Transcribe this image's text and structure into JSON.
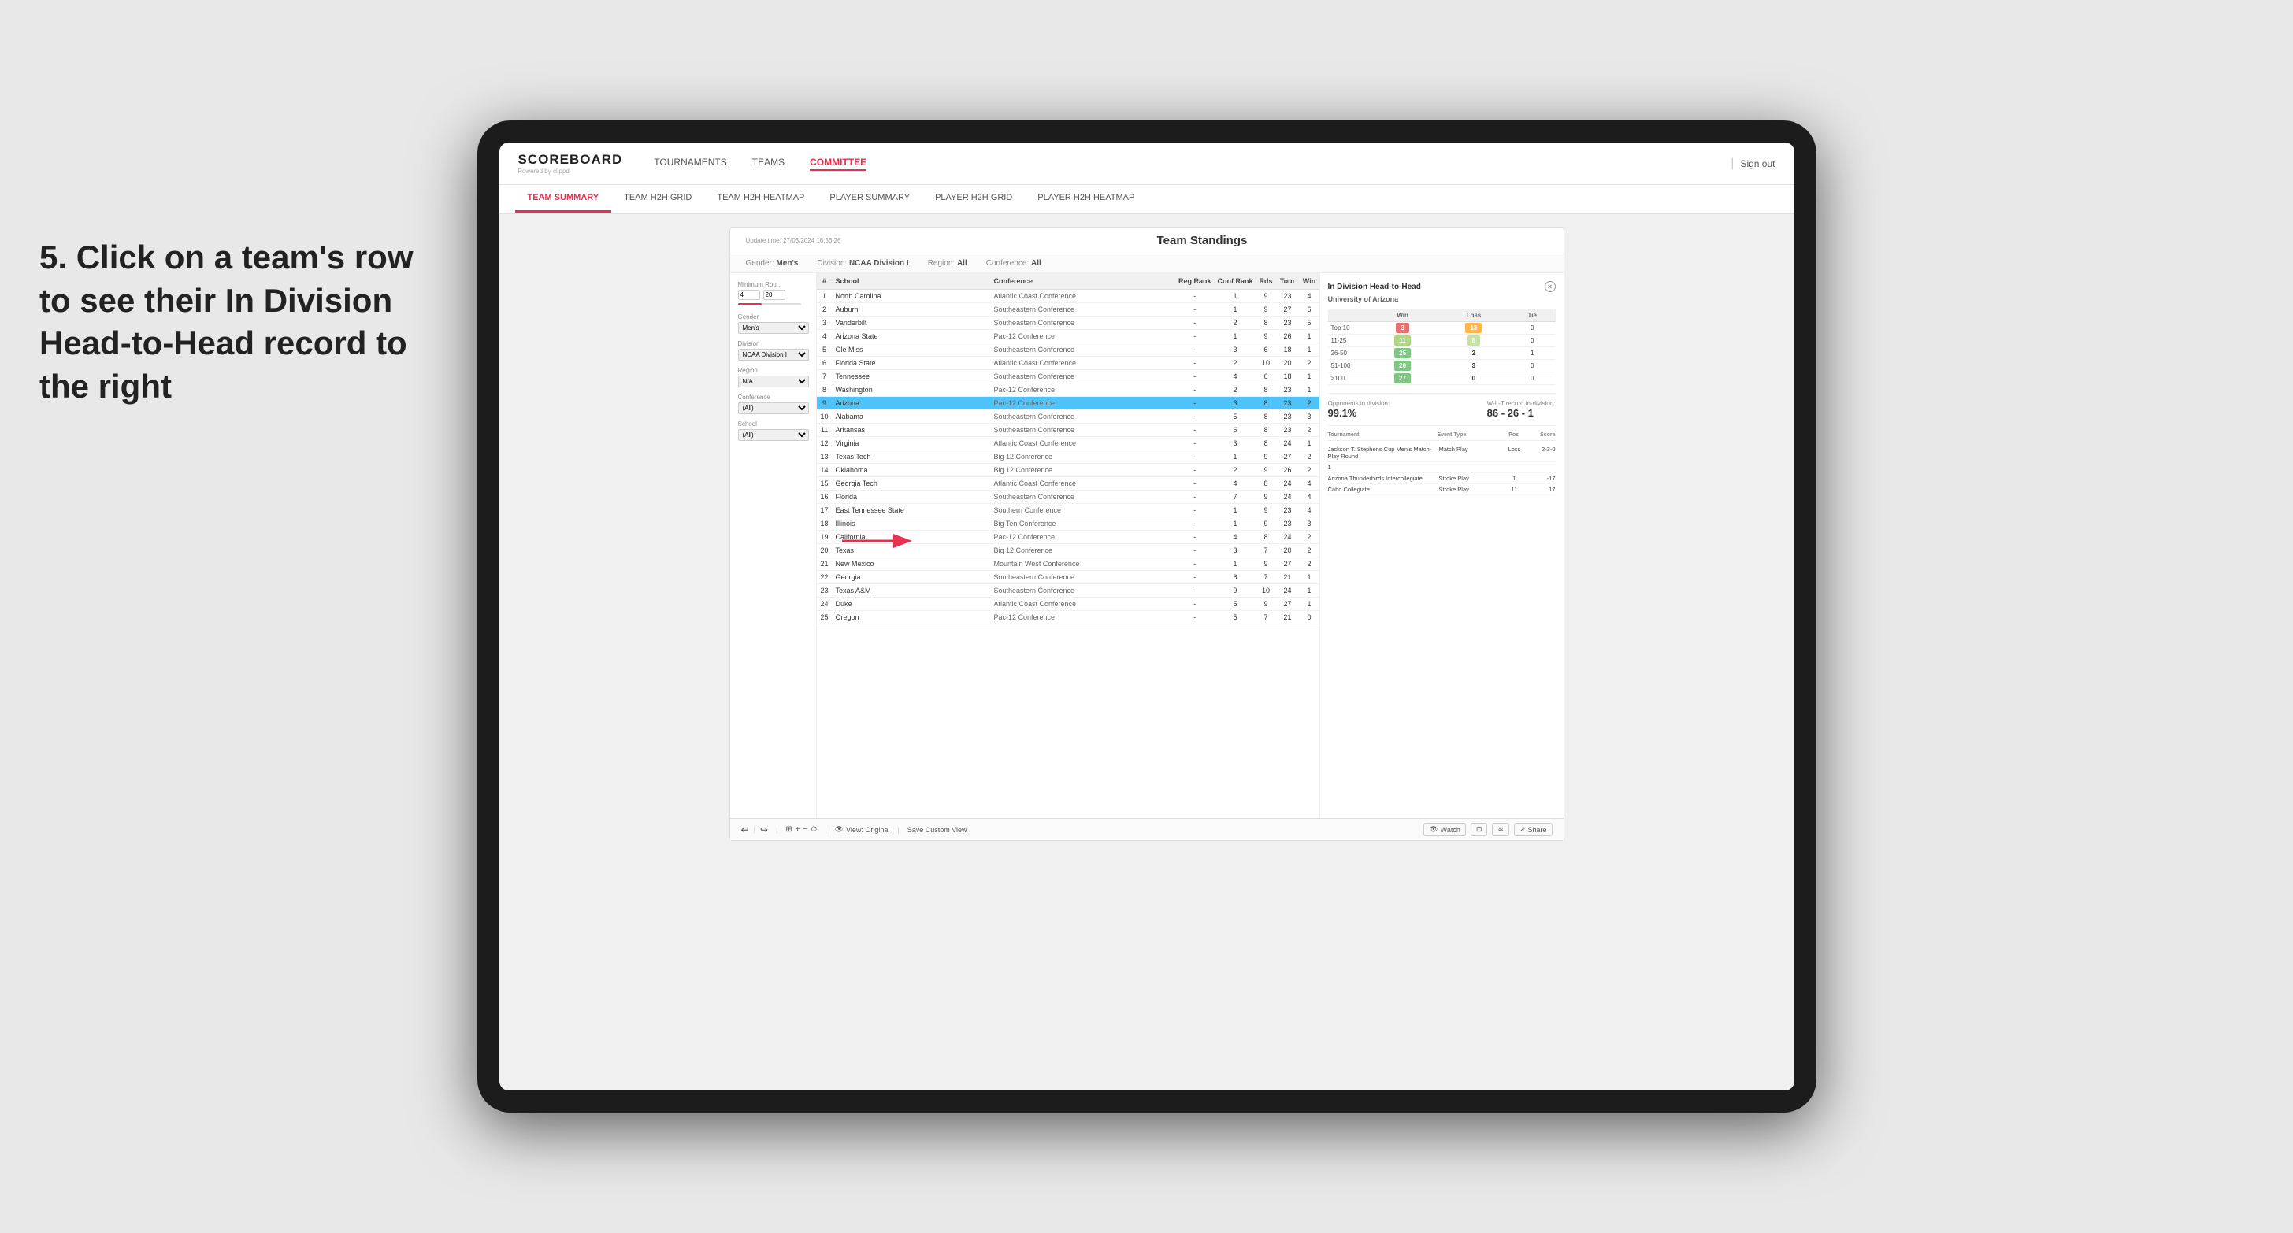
{
  "app": {
    "logo": "SCOREBOARD",
    "logo_sub": "Powered by clippd",
    "sign_out": "Sign out"
  },
  "nav": {
    "links": [
      "TOURNAMENTS",
      "TEAMS",
      "COMMITTEE"
    ],
    "active": "COMMITTEE"
  },
  "subnav": {
    "links": [
      "TEAM SUMMARY",
      "TEAM H2H GRID",
      "TEAM H2H HEATMAP",
      "PLAYER SUMMARY",
      "PLAYER H2H GRID",
      "PLAYER H2H HEATMAP"
    ],
    "active": "PLAYER SUMMARY"
  },
  "annotation": {
    "text": "5. Click on a team's row to see their In Division Head-to-Head record to the right"
  },
  "panel": {
    "update_time": "Update time:\n27/03/2024 16:56:26",
    "title": "Team Standings",
    "filters": {
      "gender_label": "Gender:",
      "gender_value": "Men's",
      "division_label": "Division:",
      "division_value": "NCAA Division I",
      "region_label": "Region:",
      "region_value": "All",
      "conference_label": "Conference:",
      "conference_value": "All"
    },
    "sidebar": {
      "min_rounds_label": "Minimum Rou...",
      "min_val": "4",
      "max_val": "20",
      "gender_label": "Gender",
      "gender_value": "Men's",
      "division_label": "Division",
      "division_value": "NCAA Division I",
      "region_label": "Region",
      "region_value": "N/A",
      "conference_label": "Conference",
      "conference_value": "(All)",
      "school_label": "School",
      "school_value": "(All)"
    },
    "table": {
      "headers": [
        "#",
        "School",
        "Conference",
        "Reg Rank",
        "Conf Rank",
        "Rds",
        "Tour",
        "Win"
      ],
      "rows": [
        {
          "num": "1",
          "school": "North Carolina",
          "conf": "Atlantic Coast Conference",
          "reg": "-",
          "crank": "1",
          "rds": "9",
          "tour": "23",
          "win": "4"
        },
        {
          "num": "2",
          "school": "Auburn",
          "conf": "Southeastern Conference",
          "reg": "-",
          "crank": "1",
          "rds": "9",
          "tour": "27",
          "win": "6"
        },
        {
          "num": "3",
          "school": "Vanderbilt",
          "conf": "Southeastern Conference",
          "reg": "-",
          "crank": "2",
          "rds": "8",
          "tour": "23",
          "win": "5"
        },
        {
          "num": "4",
          "school": "Arizona State",
          "conf": "Pac-12 Conference",
          "reg": "-",
          "crank": "1",
          "rds": "9",
          "tour": "26",
          "win": "1"
        },
        {
          "num": "5",
          "school": "Ole Miss",
          "conf": "Southeastern Conference",
          "reg": "-",
          "crank": "3",
          "rds": "6",
          "tour": "18",
          "win": "1"
        },
        {
          "num": "6",
          "school": "Florida State",
          "conf": "Atlantic Coast Conference",
          "reg": "-",
          "crank": "2",
          "rds": "10",
          "tour": "20",
          "win": "2"
        },
        {
          "num": "7",
          "school": "Tennessee",
          "conf": "Southeastern Conference",
          "reg": "-",
          "crank": "4",
          "rds": "6",
          "tour": "18",
          "win": "1"
        },
        {
          "num": "8",
          "school": "Washington",
          "conf": "Pac-12 Conference",
          "reg": "-",
          "crank": "2",
          "rds": "8",
          "tour": "23",
          "win": "1"
        },
        {
          "num": "9",
          "school": "Arizona",
          "conf": "Pac-12 Conference",
          "reg": "-",
          "crank": "3",
          "rds": "8",
          "tour": "23",
          "win": "2",
          "highlight": true
        },
        {
          "num": "10",
          "school": "Alabama",
          "conf": "Southeastern Conference",
          "reg": "-",
          "crank": "5",
          "rds": "8",
          "tour": "23",
          "win": "3"
        },
        {
          "num": "11",
          "school": "Arkansas",
          "conf": "Southeastern Conference",
          "reg": "-",
          "crank": "6",
          "rds": "8",
          "tour": "23",
          "win": "2"
        },
        {
          "num": "12",
          "school": "Virginia",
          "conf": "Atlantic Coast Conference",
          "reg": "-",
          "crank": "3",
          "rds": "8",
          "tour": "24",
          "win": "1"
        },
        {
          "num": "13",
          "school": "Texas Tech",
          "conf": "Big 12 Conference",
          "reg": "-",
          "crank": "1",
          "rds": "9",
          "tour": "27",
          "win": "2"
        },
        {
          "num": "14",
          "school": "Oklahoma",
          "conf": "Big 12 Conference",
          "reg": "-",
          "crank": "2",
          "rds": "9",
          "tour": "26",
          "win": "2"
        },
        {
          "num": "15",
          "school": "Georgia Tech",
          "conf": "Atlantic Coast Conference",
          "reg": "-",
          "crank": "4",
          "rds": "8",
          "tour": "24",
          "win": "4"
        },
        {
          "num": "16",
          "school": "Florida",
          "conf": "Southeastern Conference",
          "reg": "-",
          "crank": "7",
          "rds": "9",
          "tour": "24",
          "win": "4"
        },
        {
          "num": "17",
          "school": "East Tennessee State",
          "conf": "Southern Conference",
          "reg": "-",
          "crank": "1",
          "rds": "9",
          "tour": "23",
          "win": "4"
        },
        {
          "num": "18",
          "school": "Illinois",
          "conf": "Big Ten Conference",
          "reg": "-",
          "crank": "1",
          "rds": "9",
          "tour": "23",
          "win": "3"
        },
        {
          "num": "19",
          "school": "California",
          "conf": "Pac-12 Conference",
          "reg": "-",
          "crank": "4",
          "rds": "8",
          "tour": "24",
          "win": "2"
        },
        {
          "num": "20",
          "school": "Texas",
          "conf": "Big 12 Conference",
          "reg": "-",
          "crank": "3",
          "rds": "7",
          "tour": "20",
          "win": "2"
        },
        {
          "num": "21",
          "school": "New Mexico",
          "conf": "Mountain West Conference",
          "reg": "-",
          "crank": "1",
          "rds": "9",
          "tour": "27",
          "win": "2"
        },
        {
          "num": "22",
          "school": "Georgia",
          "conf": "Southeastern Conference",
          "reg": "-",
          "crank": "8",
          "rds": "7",
          "tour": "21",
          "win": "1"
        },
        {
          "num": "23",
          "school": "Texas A&M",
          "conf": "Southeastern Conference",
          "reg": "-",
          "crank": "9",
          "rds": "10",
          "tour": "24",
          "win": "1"
        },
        {
          "num": "24",
          "school": "Duke",
          "conf": "Atlantic Coast Conference",
          "reg": "-",
          "crank": "5",
          "rds": "9",
          "tour": "27",
          "win": "1"
        },
        {
          "num": "25",
          "school": "Oregon",
          "conf": "Pac-12 Conference",
          "reg": "-",
          "crank": "5",
          "rds": "7",
          "tour": "21",
          "win": "0"
        }
      ]
    },
    "h2h": {
      "title": "In Division Head-to-Head",
      "team": "University of Arizona",
      "win_label": "Win",
      "loss_label": "Loss",
      "tie_label": "Tie",
      "rows": [
        {
          "range": "Top 10",
          "win": "3",
          "loss": "13",
          "tie": "0",
          "win_class": "cell-red",
          "loss_class": "cell-orange"
        },
        {
          "range": "11-25",
          "win": "11",
          "loss": "8",
          "tie": "0",
          "win_class": "cell-yellow-green",
          "loss_class": "cell-light-green"
        },
        {
          "range": "26-50",
          "win": "25",
          "loss": "2",
          "tie": "1",
          "win_class": "cell-green",
          "loss_class": ""
        },
        {
          "range": "51-100",
          "win": "20",
          "loss": "3",
          "tie": "0",
          "win_class": "cell-green",
          "loss_class": ""
        },
        {
          "range": ">100",
          "win": "27",
          "loss": "0",
          "tie": "0",
          "win_class": "cell-green",
          "loss_class": ""
        }
      ],
      "opponents_label": "Opponents in division:",
      "opponents_value": "99.1%",
      "record_label": "W-L-T record in-division:",
      "record_value": "86 - 26 - 1",
      "tournaments": {
        "headers": [
          "Tournament",
          "Event Type",
          "Pos",
          "Score"
        ],
        "rows": [
          {
            "name": "Jackson T. Stephens Cup Men's Match-Play Round",
            "type": "Match Play",
            "pos": "Loss",
            "score": "2-3-0"
          },
          {
            "name": "1",
            "type": "",
            "pos": "",
            "score": ""
          },
          {
            "name": "Arizona Thunderbirds Intercollegiate",
            "type": "Stroke Play",
            "pos": "1",
            "score": "-17"
          },
          {
            "name": "Cabo Collegiate",
            "type": "Stroke Play",
            "pos": "11",
            "score": "17"
          }
        ]
      }
    }
  },
  "toolbar": {
    "undo": "↩",
    "redo": "↪",
    "view_original": "View: Original",
    "save_custom": "Save Custom View",
    "watch": "Watch",
    "share": "Share"
  }
}
